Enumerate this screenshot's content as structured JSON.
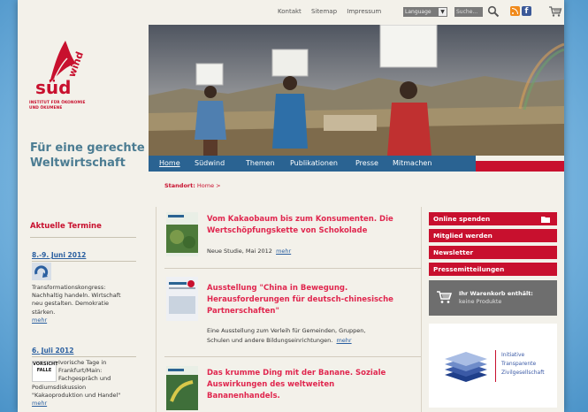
{
  "top_links": [
    "Kontakt",
    "Sitemap",
    "Impressum"
  ],
  "language_select": "Language",
  "search": {
    "placeholder": "Suche..."
  },
  "logo": {
    "wordmark": "süd wind",
    "institute_line1": "INSTITUT FÜR ÖKONOMIE",
    "institute_line2": "UND ÖKUMENE"
  },
  "tagline_line1": "Für eine gerechte",
  "tagline_line2": "Weltwirtschaft",
  "nav": {
    "items": [
      "Home",
      "Südwind",
      "Themen",
      "Publikationen",
      "Presse",
      "Mitmachen"
    ],
    "active": "Home"
  },
  "breadcrumb": {
    "label": "Standort:",
    "current": "Home >"
  },
  "termine": {
    "title": "Aktuelle Termine",
    "events": [
      {
        "date": "8.-9. Juni 2012",
        "lines": [
          "Transformationskongress:",
          "Nachhaltig handeln. Wirtschaft",
          "neu gestalten. Demokratie",
          "stärken."
        ],
        "more": "mehr"
      },
      {
        "date": "6. Juli 2012",
        "badge": "VORSICHT FALLE",
        "lines": [
          "Ivorische Tage in",
          "Frankfurt/Main:",
          "Fachgespräch und",
          "Podiumsdiskussion",
          "\"Kakaoproduktion und Handel\""
        ],
        "more": "mehr"
      }
    ]
  },
  "articles": [
    {
      "title_lines": [
        "Vom Kakaobaum bis zum Konsumenten. Die",
        "Wertschöpfungskette von Schokolade"
      ],
      "text_lines": [
        "Neue Studie, Mai 2012"
      ],
      "more": "mehr"
    },
    {
      "title_lines": [
        "Ausstellung \"China in Bewegung.",
        "Herausforderungen für deutsch-chinesische",
        "Partnerschaften\""
      ],
      "text_lines": [
        "Eine Ausstellung zum Verleih für Gemeinden, Gruppen,",
        "Schulen und andere Bildungseinrichtungen."
      ],
      "more": "mehr"
    },
    {
      "title_lines": [
        "Das krumme Ding mit der Banane. Soziale",
        "Auswirkungen des weltweiten",
        "Bananenhandels."
      ],
      "text_lines": [],
      "more": ""
    }
  ],
  "sidebar_buttons": [
    "Online spenden",
    "Mitglied werden",
    "Newsletter",
    "Pressemitteilungen"
  ],
  "cart": {
    "label": "Ihr Warenkorb enthält:",
    "status": "keine Produkte"
  },
  "itz": {
    "line1": "Initiative",
    "line2": "Transparente",
    "line3": "Zivilgesellschaft"
  },
  "colors": {
    "brand_red": "#c8102e",
    "nav_blue": "#2a6392",
    "link_blue": "#2a5fa0",
    "article_pink": "#e0264e"
  }
}
